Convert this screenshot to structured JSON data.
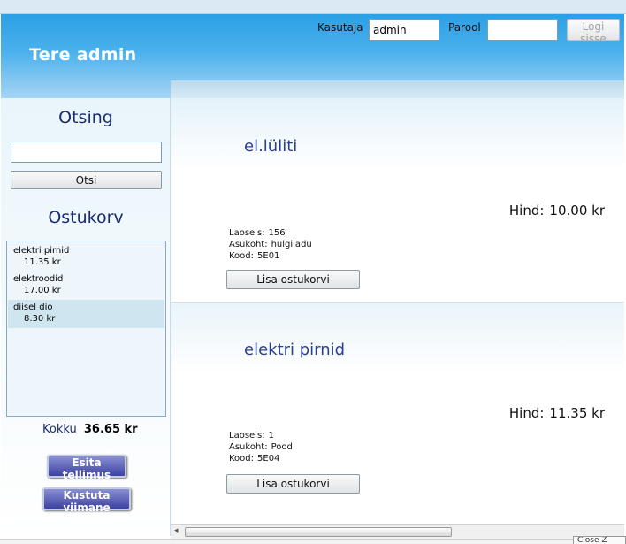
{
  "header": {
    "greeting": "Tere admin",
    "username_label": "Kasutaja",
    "username_value": "admin",
    "password_label": "Parool",
    "password_value": "",
    "login_button": "Logi sisse"
  },
  "sidebar": {
    "search_title": "Otsing",
    "search_value": "",
    "search_button": "Otsi",
    "cart_title": "Ostukorv",
    "cart_items": [
      {
        "name": "elektri pirnid",
        "price": "11.35 kr",
        "selected": false
      },
      {
        "name": "elektroodid",
        "price": "17.00 kr",
        "selected": false
      },
      {
        "name": "diisel dio",
        "price": "8.30 kr",
        "selected": true
      }
    ],
    "total_label": "Kokku",
    "total_value": "36.65 kr",
    "order_button": "Esita tellimus",
    "delete_button": "Kustuta viimane"
  },
  "products": [
    {
      "name": "el.lüliti",
      "price_label": "Hind:",
      "price": "10.00 kr",
      "stock_label": "Laoseis:",
      "stock": "156",
      "location_label": "Asukoht:",
      "location": "hulgiladu",
      "code_label": "Kood:",
      "code": "5E01",
      "add_button": "Lisa ostukorvi"
    },
    {
      "name": "elektri pirnid",
      "price_label": "Hind:",
      "price": "11.35 kr",
      "stock_label": "Laoseis:",
      "stock": "1",
      "location_label": "Asukoht:",
      "location": "Pood",
      "code_label": "Kood:",
      "code": "5E04",
      "add_button": "Lisa ostukorvi"
    }
  ],
  "taskbar": {
    "corner_text": "Close Z"
  },
  "colors": {
    "header_top": "#2aa0e6",
    "header_bottom": "#a7d5f4",
    "title_text": "#1a2c6e",
    "product_name": "#2a3f8f",
    "action_button": "#3c42a0",
    "selected_row": "#cfe6f1"
  },
  "icons": {
    "scroll_left": "arrow-left-icon"
  }
}
